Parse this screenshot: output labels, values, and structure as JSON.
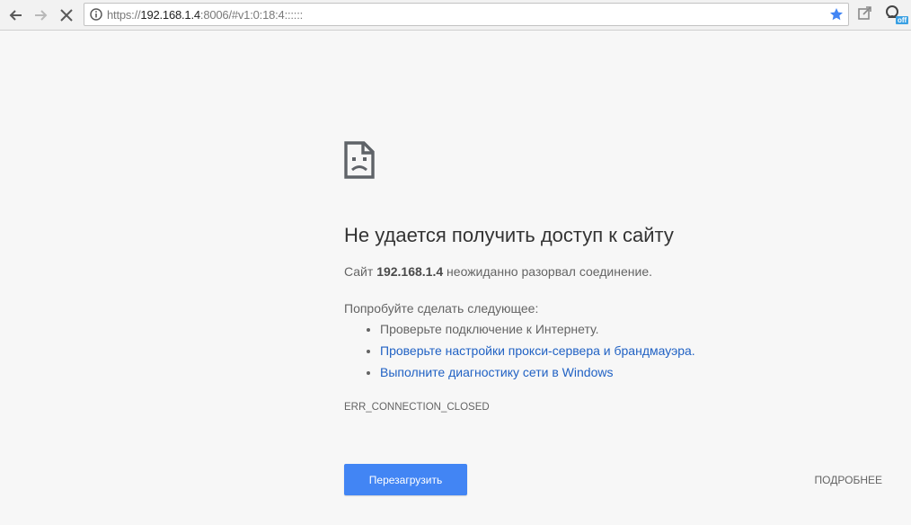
{
  "browser": {
    "url_scheme": "https://",
    "url_host": "192.168.1.4",
    "url_rest": ":8006/#v1:0:18:4::::::",
    "ext_badge": "off",
    "accent": "#4285f4"
  },
  "error": {
    "heading": "Не удается получить доступ к сайту",
    "summary_prefix": "Сайт ",
    "summary_host": "192.168.1.4",
    "summary_suffix": " неожиданно разорвал соединение.",
    "suggestions_title": "Попробуйте сделать следующее:",
    "suggestions": [
      {
        "text": "Проверьте подключение к Интернету.",
        "link": false
      },
      {
        "text": "Проверьте настройки прокси-сервера и брандмауэра.",
        "link": true
      },
      {
        "text": "Выполните диагностику сети в Windows",
        "link": true
      }
    ],
    "code": "ERR_CONNECTION_CLOSED",
    "reload_label": "Перезагрузить",
    "details_label": "ПОДРОБНЕЕ"
  }
}
